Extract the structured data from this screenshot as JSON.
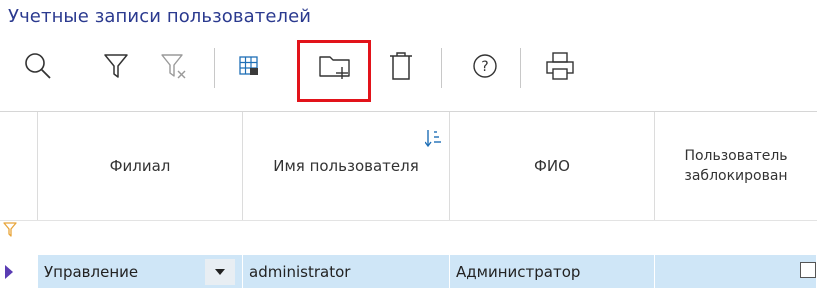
{
  "page": {
    "title": "Учетные записи пользователей"
  },
  "toolbar": {
    "buttons": [
      {
        "icon": "search-icon"
      },
      {
        "icon": "filter-icon"
      },
      {
        "icon": "clear-filter-icon"
      },
      {
        "icon": "grid-settings-icon"
      },
      {
        "icon": "add-folder-icon"
      },
      {
        "icon": "delete-icon"
      },
      {
        "icon": "help-icon"
      },
      {
        "icon": "print-icon"
      }
    ],
    "highlight_color": "#e2131a"
  },
  "grid": {
    "columns": [
      {
        "label": "Филиал"
      },
      {
        "label": "Имя пользователя"
      },
      {
        "label": "ФИО"
      },
      {
        "label_line1": "Пользователь",
        "label_line2": "заблокирован"
      }
    ],
    "rows": [
      {
        "branch": "Управление",
        "username": "administrator",
        "fullname": "Администратор",
        "blocked": false
      }
    ],
    "selection_color": "#cfe6f7",
    "filter_icon_color": "#e8a53a"
  }
}
